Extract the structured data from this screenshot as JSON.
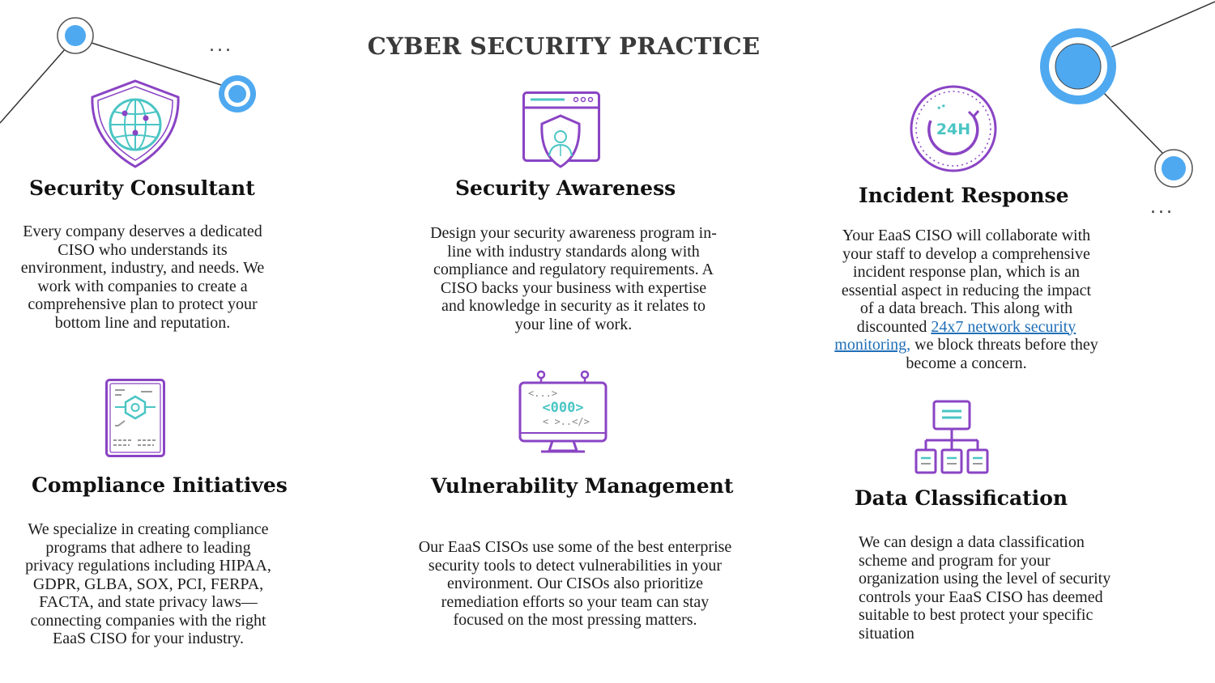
{
  "page": {
    "title": "CYBER SECURITY PRACTICE"
  },
  "colors": {
    "purple": "#8a44c4",
    "teal": "#4ac5c4",
    "blue": "#4fa9f0",
    "link": "#1f6fb7"
  },
  "cards": {
    "consultant": {
      "icon": "shield-globe-icon",
      "heading": "Security Consultant",
      "body": "Every company deserves a dedicated CISO who understands its environment, industry, and needs. We work with companies to create a comprehensive plan to protect your bottom line and reputation."
    },
    "awareness": {
      "icon": "browser-user-shield-icon",
      "heading": "Security Awareness",
      "body": "Design your security awareness program in-line with industry standards along with compliance and regulatory requirements. A CISO backs your business with expertise and knowledge in security as it relates to your line of work."
    },
    "incident": {
      "icon": "clock-24h-icon",
      "heading": "Incident Response",
      "body_before": "Your EaaS CISO will collaborate with your staff to develop a comprehensive incident response plan, which is an essential aspect in reducing the impact of a data breach. This along with discounted ",
      "link_text": "24x7 network security monitoring,",
      "body_after": " we block threats before they become a concern."
    },
    "compliance": {
      "icon": "document-gear-icon",
      "heading": "Compliance Initiatives",
      "body": "We specialize in creating compliance programs that adhere to leading privacy regulations including HIPAA, GDPR, GLBA, SOX, PCI, FERPA, FACTA, and state privacy laws—connecting companies with the right EaaS CISO for your industry."
    },
    "vulnerability": {
      "icon": "monitor-code-icon",
      "heading": "Vulnerability Management",
      "body": "Our EaaS CISOs use some of the best enterprise security tools to detect vulnerabilities in your environment. Our CISOs also prioritize remediation efforts so your team can stay focused on the most pressing matters.",
      "code_top": "<...>",
      "code_mid": "<000>",
      "code_bot": "< >..</>"
    },
    "classification": {
      "icon": "hierarchy-database-icon",
      "heading": "Data Classification",
      "body": "We can design a data classification scheme and program for your organization using the level of security controls your EaaS CISO has deemed suitable to best protect your specific situation"
    }
  },
  "decor": {
    "dots": "...",
    "clock_label": "24H"
  }
}
